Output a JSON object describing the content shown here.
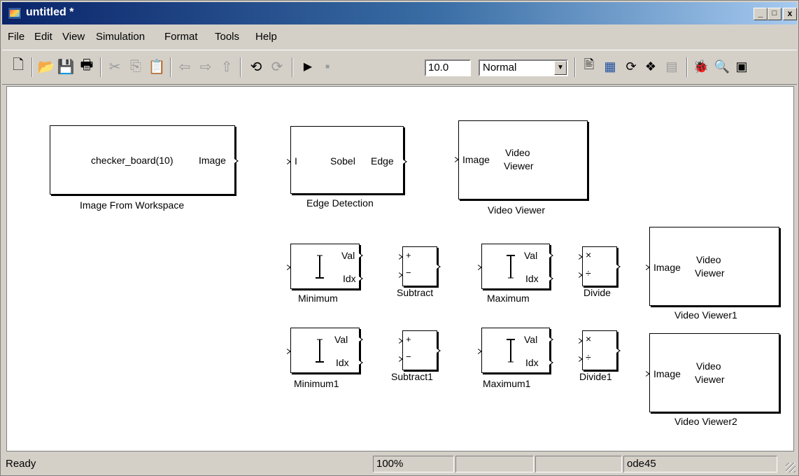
{
  "window": {
    "title": "untitled *",
    "controls": {
      "minimize": "_",
      "maximize": "□",
      "close": "x"
    }
  },
  "menu": {
    "items": [
      "File",
      "Edit",
      "View",
      "Simulation",
      "Format",
      "Tools",
      "Help"
    ]
  },
  "toolbar": {
    "icons": [
      "new-document",
      "open-folder",
      "save",
      "print",
      "cut",
      "copy",
      "paste",
      "back",
      "forward",
      "up",
      "undo",
      "redo",
      "start-simulation",
      "stop-simulation",
      "build",
      "model-advisor",
      "update-diagram",
      "library-browser",
      "model-explorer",
      "debug",
      "profiler",
      "go-to-parent"
    ],
    "stop_time": "10.0",
    "sim_mode": "Normal"
  },
  "blocks": {
    "image_from_workspace": {
      "content": "checker_board(10)",
      "port_out": "Image",
      "name": "Image From Workspace"
    },
    "edge_detection": {
      "port_in": "I",
      "content": "Sobel",
      "port_out": "Edge",
      "name": "Edge Detection"
    },
    "video_viewer": {
      "port_in": "Image",
      "content_1": "Video",
      "content_2": "Viewer",
      "name": "Video Viewer"
    },
    "minimum": {
      "port_val": "Val",
      "port_idx": "Idx",
      "name": "Minimum"
    },
    "subtract": {
      "plus": "+",
      "minus": "−",
      "name": "Subtract"
    },
    "maximum": {
      "port_val": "Val",
      "port_idx": "Idx",
      "name": "Maximum"
    },
    "divide": {
      "times": "×",
      "div": "÷",
      "name": "Divide"
    },
    "video_viewer1": {
      "port_in": "Image",
      "content_1": "Video",
      "content_2": "Viewer",
      "name": "Video Viewer1"
    },
    "minimum1": {
      "port_val": "Val",
      "port_idx": "Idx",
      "name": "Minimum1"
    },
    "subtract1": {
      "plus": "+",
      "minus": "−",
      "name": "Subtract1"
    },
    "maximum1": {
      "port_val": "Val",
      "port_idx": "Idx",
      "name": "Maximum1"
    },
    "divide1": {
      "times": "×",
      "div": "÷",
      "name": "Divide1"
    },
    "video_viewer2": {
      "port_in": "Image",
      "content_1": "Video",
      "content_2": "Viewer",
      "name": "Video Viewer2"
    }
  },
  "status": {
    "state": "Ready",
    "zoom": "100%",
    "solver": "ode45"
  }
}
